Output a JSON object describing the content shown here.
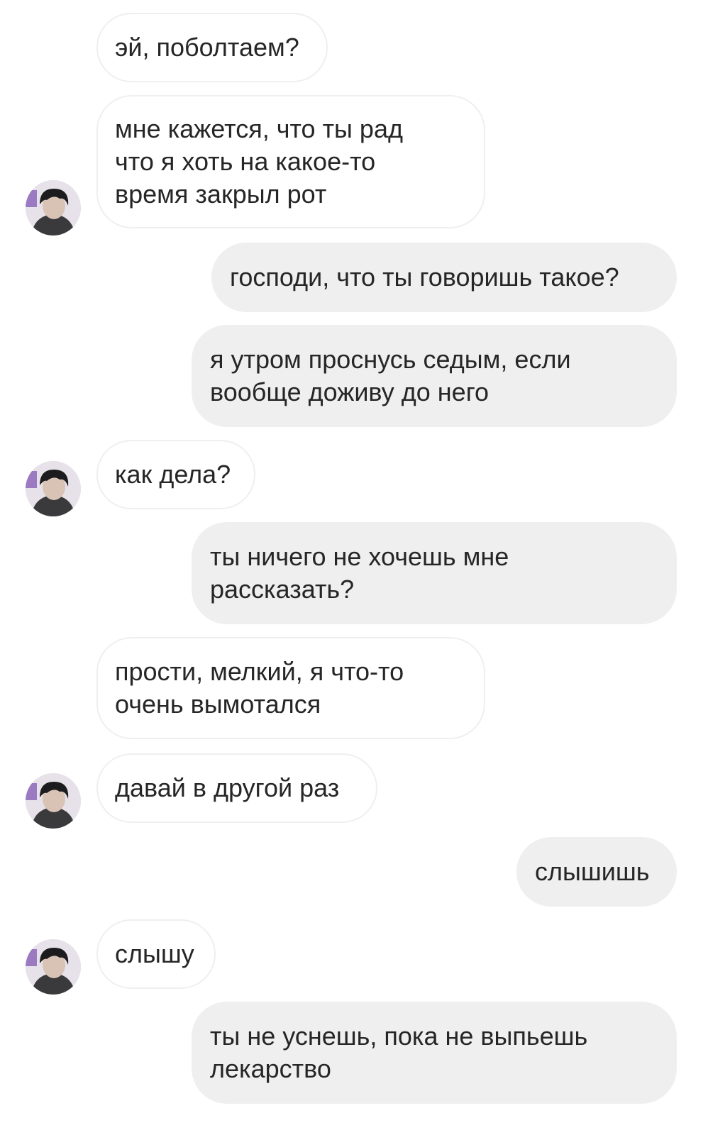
{
  "messages": [
    {
      "side": "in",
      "text": "эй, поболтаем?"
    },
    {
      "side": "in",
      "text": "мне кажется, что ты рад\nчто я хоть на какое-то\nвремя закрыл рот"
    },
    {
      "side": "out",
      "text": "господи, что ты говоришь такое?"
    },
    {
      "side": "out",
      "text": "я утром проснусь седым, если\nвообще доживу до него"
    },
    {
      "side": "in",
      "text": "как дела?"
    },
    {
      "side": "out",
      "text": "ты ничего не хочешь мне\nрассказать?"
    },
    {
      "side": "in",
      "text": "прости, мелкий, я что-то\nочень вымотался"
    },
    {
      "side": "in",
      "text": "давай в другой раз"
    },
    {
      "side": "out",
      "text": "слышишь"
    },
    {
      "side": "in",
      "text": "слышу"
    },
    {
      "side": "out",
      "text": "ты не уснешь, пока не выпьешь\nлекарство"
    }
  ],
  "avatar": {
    "icon": "profile-photo",
    "colors": {
      "bg": "#e7e2ea",
      "hair": "#1c1c1e",
      "skin": "#d9c3b4",
      "hoodie": "#3a3a3c",
      "accent": "#7b4fb0"
    }
  },
  "colors": {
    "incoming_bg": "#ffffff",
    "incoming_border": "#efefef",
    "outgoing_bg": "#efefef",
    "text": "#262626"
  }
}
